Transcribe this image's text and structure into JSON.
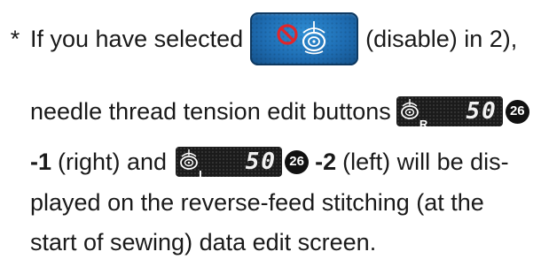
{
  "line1": {
    "asterisk": "*",
    "before": "If you have selected",
    "after": "(disable) in 2),"
  },
  "line2": {
    "text": "needle thread tension edit buttons",
    "button_value": "50",
    "button_side": "R",
    "badge": "26"
  },
  "line3": {
    "ref1": "-1",
    "mid": "(right) and",
    "button_value": "50",
    "button_side": "L",
    "badge": "26",
    "ref2": "-2",
    "end": "(left) will be dis-"
  },
  "line4": {
    "text": "played on the reverse-feed stitching (at the"
  },
  "line5": {
    "text": "start of sewing) data edit screen."
  },
  "colors": {
    "disable_button": "#1e6db3",
    "tension_button": "#1b1b1b",
    "prohibit_red": "#e0262b"
  },
  "icons": {
    "disable_button": "prohibit-thread-tension-icon",
    "tension_button": "thread-tension-dial-icon"
  }
}
